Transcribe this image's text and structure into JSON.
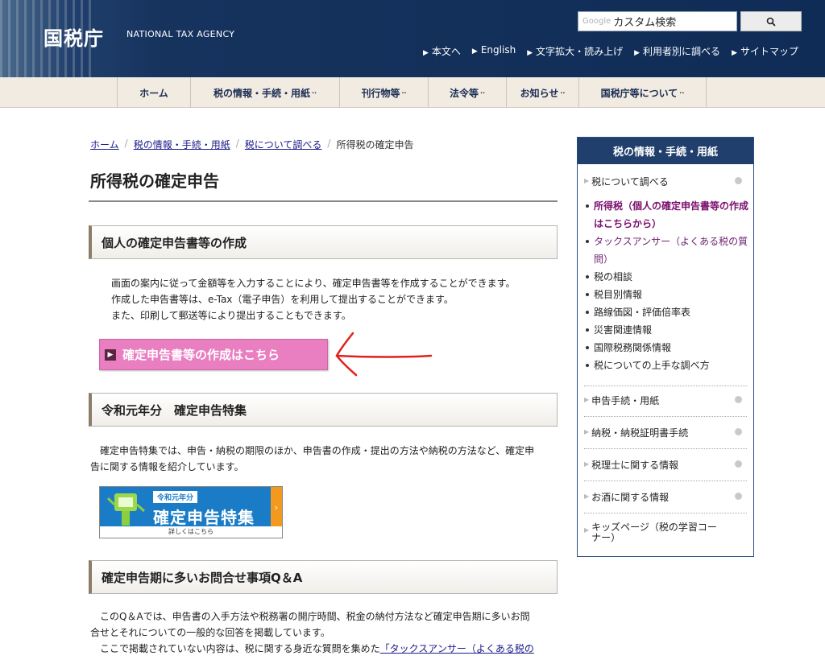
{
  "header": {
    "logo_ja": "国税庁",
    "logo_en": "NATIONAL TAX AGENCY",
    "search": {
      "brand": "Google",
      "placeholder": "カスタム検索",
      "button_icon": "search-icon"
    },
    "util_links": [
      "本文へ",
      "English",
      "文字拡大・読み上げ",
      "利用者別に調べる",
      "サイトマップ"
    ]
  },
  "nav": {
    "items": [
      {
        "label": "ホーム",
        "dropdown": false
      },
      {
        "label": "税の情報・手続・用紙",
        "dropdown": true
      },
      {
        "label": "刊行物等",
        "dropdown": true
      },
      {
        "label": "法令等",
        "dropdown": true
      },
      {
        "label": "お知らせ",
        "dropdown": true
      },
      {
        "label": "国税庁等について",
        "dropdown": true
      }
    ],
    "dropdown_mark": "··"
  },
  "breadcrumb": {
    "items": [
      "ホーム",
      "税の情報・手続・用紙",
      "税について調べる",
      "所得税の確定申告"
    ],
    "separator": "/"
  },
  "main": {
    "title": "所得税の確定申告",
    "section1": {
      "heading": "個人の確定申告書等の作成",
      "lines": [
        "画面の案内に従って金額等を入力することにより、確定申告書等を作成することができます。",
        "作成した申告書等は、e-Tax（電子申告）を利用して提出することができます。",
        "また、印刷して郵送等により提出することもできます。"
      ],
      "button": "確定申告書等の作成はこちら"
    },
    "section2": {
      "heading": "令和元年分　確定申告特集",
      "lines": [
        "確定申告特集では、申告・納税の期限のほか、申告書の作成・提出の方法や納税の方法など、確定申",
        "告に関する情報を紹介しています。"
      ],
      "banner": {
        "small": "令和元年分",
        "main": "確定申告特集",
        "foot": "詳しくはこちら"
      }
    },
    "section3": {
      "heading": "確定申告期に多いお問合せ事項Q＆A",
      "lines": [
        "このQ＆Aでは、申告書の入手方法や税務署の開庁時間、税金の納付方法など確定申告期に多いお問",
        "合せとそれについての一般的な回答を掲載しています。"
      ],
      "line3_prefix": "ここで掲載されていない内容は、税に関する身近な質問を集めた",
      "line3_link": "「タックスアンサー（よくある税の"
    }
  },
  "sidebar": {
    "heading": "税の情報・手続・用紙",
    "top_item": "税について調べる",
    "sub_items": [
      {
        "label": "所得税（個人の確定申告書等の作成はこちらから）",
        "state": "active"
      },
      {
        "label": "タックスアンサー（よくある税の質問）",
        "state": "link"
      },
      {
        "label": "税の相談",
        "state": "normal"
      },
      {
        "label": "税目別情報",
        "state": "normal"
      },
      {
        "label": "路線価図・評価倍率表",
        "state": "normal"
      },
      {
        "label": "災害関連情報",
        "state": "normal"
      },
      {
        "label": "国際税務関係情報",
        "state": "normal"
      },
      {
        "label": "税についての上手な調べ方",
        "state": "normal"
      }
    ],
    "items": [
      "申告手続・用紙",
      "納税・納税証明書手続",
      "税理士に関する情報",
      "お酒に関する情報",
      "キッズページ（税の学習コーナー）"
    ]
  },
  "colors": {
    "header_bg": "#16335e",
    "nav_bg": "#f2ebe2",
    "pink_button": "#e97ec0",
    "sidebar_head": "#203f6c",
    "active_link": "#7a0f6c",
    "annotation_arrow": "#e0211d"
  }
}
